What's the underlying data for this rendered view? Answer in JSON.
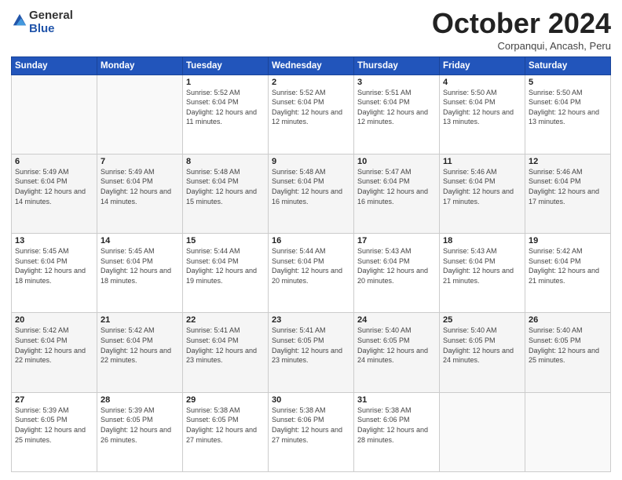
{
  "header": {
    "logo_line1": "General",
    "logo_line2": "Blue",
    "month": "October 2024",
    "location": "Corpanqui, Ancash, Peru"
  },
  "days_of_week": [
    "Sunday",
    "Monday",
    "Tuesday",
    "Wednesday",
    "Thursday",
    "Friday",
    "Saturday"
  ],
  "weeks": [
    [
      {
        "day": "",
        "info": ""
      },
      {
        "day": "",
        "info": ""
      },
      {
        "day": "1",
        "info": "Sunrise: 5:52 AM\nSunset: 6:04 PM\nDaylight: 12 hours and 11 minutes."
      },
      {
        "day": "2",
        "info": "Sunrise: 5:52 AM\nSunset: 6:04 PM\nDaylight: 12 hours and 12 minutes."
      },
      {
        "day": "3",
        "info": "Sunrise: 5:51 AM\nSunset: 6:04 PM\nDaylight: 12 hours and 12 minutes."
      },
      {
        "day": "4",
        "info": "Sunrise: 5:50 AM\nSunset: 6:04 PM\nDaylight: 12 hours and 13 minutes."
      },
      {
        "day": "5",
        "info": "Sunrise: 5:50 AM\nSunset: 6:04 PM\nDaylight: 12 hours and 13 minutes."
      }
    ],
    [
      {
        "day": "6",
        "info": "Sunrise: 5:49 AM\nSunset: 6:04 PM\nDaylight: 12 hours and 14 minutes."
      },
      {
        "day": "7",
        "info": "Sunrise: 5:49 AM\nSunset: 6:04 PM\nDaylight: 12 hours and 14 minutes."
      },
      {
        "day": "8",
        "info": "Sunrise: 5:48 AM\nSunset: 6:04 PM\nDaylight: 12 hours and 15 minutes."
      },
      {
        "day": "9",
        "info": "Sunrise: 5:48 AM\nSunset: 6:04 PM\nDaylight: 12 hours and 16 minutes."
      },
      {
        "day": "10",
        "info": "Sunrise: 5:47 AM\nSunset: 6:04 PM\nDaylight: 12 hours and 16 minutes."
      },
      {
        "day": "11",
        "info": "Sunrise: 5:46 AM\nSunset: 6:04 PM\nDaylight: 12 hours and 17 minutes."
      },
      {
        "day": "12",
        "info": "Sunrise: 5:46 AM\nSunset: 6:04 PM\nDaylight: 12 hours and 17 minutes."
      }
    ],
    [
      {
        "day": "13",
        "info": "Sunrise: 5:45 AM\nSunset: 6:04 PM\nDaylight: 12 hours and 18 minutes."
      },
      {
        "day": "14",
        "info": "Sunrise: 5:45 AM\nSunset: 6:04 PM\nDaylight: 12 hours and 18 minutes."
      },
      {
        "day": "15",
        "info": "Sunrise: 5:44 AM\nSunset: 6:04 PM\nDaylight: 12 hours and 19 minutes."
      },
      {
        "day": "16",
        "info": "Sunrise: 5:44 AM\nSunset: 6:04 PM\nDaylight: 12 hours and 20 minutes."
      },
      {
        "day": "17",
        "info": "Sunrise: 5:43 AM\nSunset: 6:04 PM\nDaylight: 12 hours and 20 minutes."
      },
      {
        "day": "18",
        "info": "Sunrise: 5:43 AM\nSunset: 6:04 PM\nDaylight: 12 hours and 21 minutes."
      },
      {
        "day": "19",
        "info": "Sunrise: 5:42 AM\nSunset: 6:04 PM\nDaylight: 12 hours and 21 minutes."
      }
    ],
    [
      {
        "day": "20",
        "info": "Sunrise: 5:42 AM\nSunset: 6:04 PM\nDaylight: 12 hours and 22 minutes."
      },
      {
        "day": "21",
        "info": "Sunrise: 5:42 AM\nSunset: 6:04 PM\nDaylight: 12 hours and 22 minutes."
      },
      {
        "day": "22",
        "info": "Sunrise: 5:41 AM\nSunset: 6:04 PM\nDaylight: 12 hours and 23 minutes."
      },
      {
        "day": "23",
        "info": "Sunrise: 5:41 AM\nSunset: 6:05 PM\nDaylight: 12 hours and 23 minutes."
      },
      {
        "day": "24",
        "info": "Sunrise: 5:40 AM\nSunset: 6:05 PM\nDaylight: 12 hours and 24 minutes."
      },
      {
        "day": "25",
        "info": "Sunrise: 5:40 AM\nSunset: 6:05 PM\nDaylight: 12 hours and 24 minutes."
      },
      {
        "day": "26",
        "info": "Sunrise: 5:40 AM\nSunset: 6:05 PM\nDaylight: 12 hours and 25 minutes."
      }
    ],
    [
      {
        "day": "27",
        "info": "Sunrise: 5:39 AM\nSunset: 6:05 PM\nDaylight: 12 hours and 25 minutes."
      },
      {
        "day": "28",
        "info": "Sunrise: 5:39 AM\nSunset: 6:05 PM\nDaylight: 12 hours and 26 minutes."
      },
      {
        "day": "29",
        "info": "Sunrise: 5:38 AM\nSunset: 6:05 PM\nDaylight: 12 hours and 27 minutes."
      },
      {
        "day": "30",
        "info": "Sunrise: 5:38 AM\nSunset: 6:06 PM\nDaylight: 12 hours and 27 minutes."
      },
      {
        "day": "31",
        "info": "Sunrise: 5:38 AM\nSunset: 6:06 PM\nDaylight: 12 hours and 28 minutes."
      },
      {
        "day": "",
        "info": ""
      },
      {
        "day": "",
        "info": ""
      }
    ]
  ]
}
